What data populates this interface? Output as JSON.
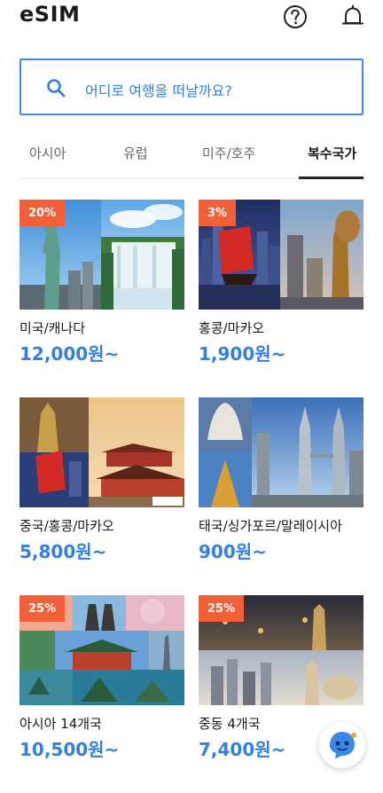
{
  "header": {
    "title": "eSIM",
    "help_icon": "question-circle-icon",
    "notification_icon": "bell-icon"
  },
  "search": {
    "placeholder": "어디로 여행을 떠날까요?",
    "icon": "search-icon",
    "accent": "#3d8ae8"
  },
  "tabs": [
    {
      "label": "아시아",
      "active": false
    },
    {
      "label": "유럽",
      "active": false
    },
    {
      "label": "미주/호주",
      "active": false
    },
    {
      "label": "복수국가",
      "active": true
    }
  ],
  "cards": [
    {
      "name": "미국/캐나다",
      "price": "12,000원~",
      "badge": "20%"
    },
    {
      "name": "홍콩/마카오",
      "price": "1,900원~",
      "badge": "3%"
    },
    {
      "name": "중국/홍콩/마카오",
      "price": "5,800원~",
      "badge": ""
    },
    {
      "name": "태국/싱가포르/말레이시아",
      "price": "900원~",
      "badge": ""
    },
    {
      "name": "아시아 14개국",
      "price": "10,500원~",
      "badge": "25%"
    },
    {
      "name": "중동 4개국",
      "price": "7,400원~",
      "badge": "25%"
    }
  ],
  "colors": {
    "price": "#2f7fe6",
    "badge": "#f2603a"
  },
  "chat_button": {
    "icon": "chatbot-icon"
  }
}
